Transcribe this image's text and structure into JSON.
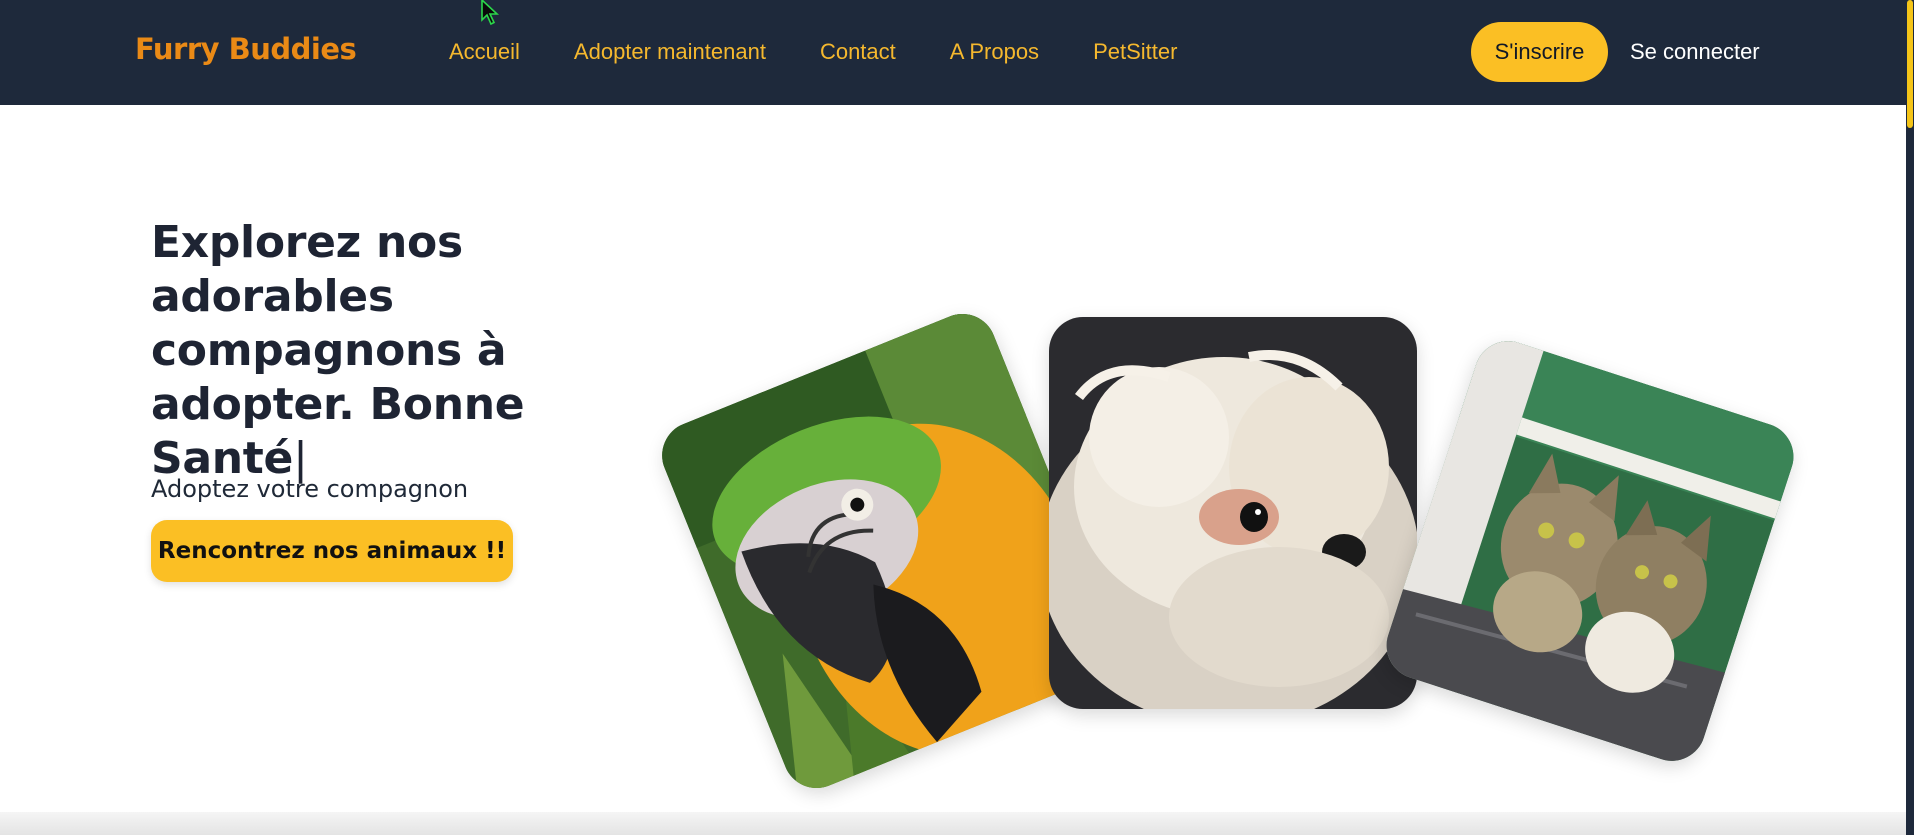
{
  "navbar": {
    "brand": "Furry Buddies",
    "links": [
      "Accueil",
      "Adopter maintenant",
      "Contact",
      "A Propos",
      "PetSitter"
    ],
    "signup_label": "S'inscrire",
    "login_label": "Se connecter"
  },
  "hero": {
    "title": "Explorez nos adorables compagnons à adopter. Bonne Santé",
    "caret": "|",
    "subtitle": "Adoptez votre compagnon",
    "cta_label": "Rencontrez nos animaux !!"
  },
  "gallery": {
    "images": [
      {
        "subject": "parrot",
        "icon": "parrot-photo"
      },
      {
        "subject": "dog",
        "icon": "dog-photo"
      },
      {
        "subject": "cats",
        "icon": "cats-photo"
      }
    ]
  },
  "colors": {
    "navbar_bg": "#1e293b",
    "brand": "#ea8a16",
    "nav_link": "#f5b82e",
    "accent": "#fbbf24",
    "heading": "#1e2433"
  }
}
